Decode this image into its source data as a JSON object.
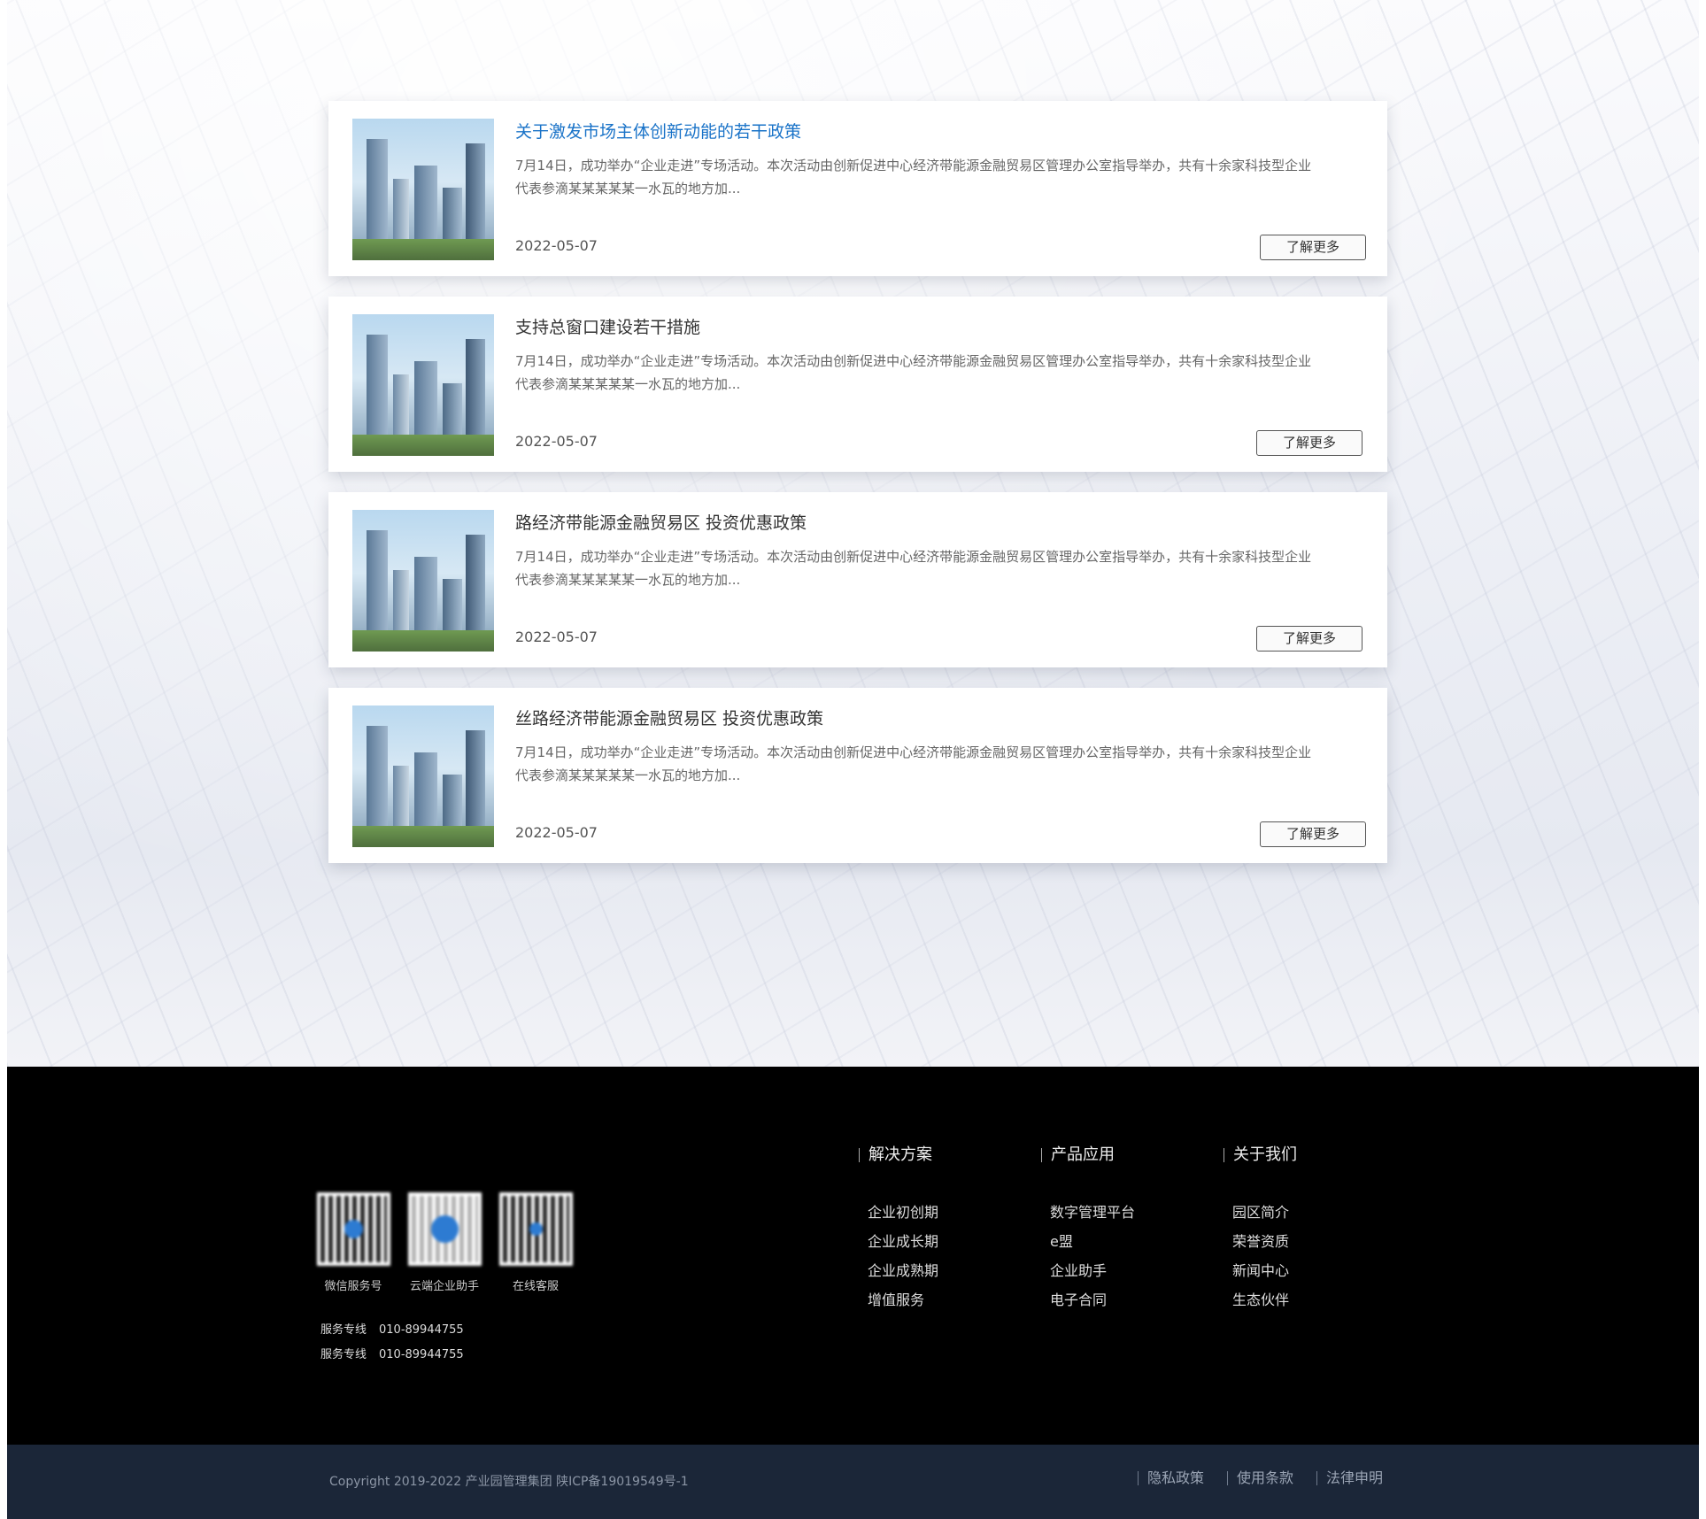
{
  "articles": [
    {
      "title": "关于激发市场主体创新动能的若干政策",
      "desc": "7月14日，成功举办“企业走进”专场活动。本次活动由创新促进中心经济带能源金融贸易区管理办公室指导举办，共有十余家科技型企业\n代表参滴某某某某某一水瓦的地方加...",
      "date": "2022-05-07",
      "more": "了解更多"
    },
    {
      "title": "支持总窗口建设若干措施",
      "desc": "7月14日，成功举办“企业走进”专场活动。本次活动由创新促进中心经济带能源金融贸易区管理办公室指导举办，共有十余家科技型企业\n代表参滴某某某某某一水瓦的地方加...",
      "date": "2022-05-07",
      "more": "了解更多"
    },
    {
      "title": "路经济带能源金融贸易区 投资优惠政策",
      "desc": "7月14日，成功举办“企业走进”专场活动。本次活动由创新促进中心经济带能源金融贸易区管理办公室指导举办，共有十余家科技型企业\n代表参滴某某某某某一水瓦的地方加...",
      "date": "2022-05-07",
      "more": "了解更多"
    },
    {
      "title": "丝路经济带能源金融贸易区 投资优惠政策",
      "desc": "7月14日，成功举办“企业走进”专场活动。本次活动由创新促进中心经济带能源金融贸易区管理办公室指导举办，共有十余家科技型企业\n代表参滴某某某某某一水瓦的地方加...",
      "date": "2022-05-07",
      "more": "了解更多"
    }
  ],
  "footer": {
    "qrcodes": [
      {
        "label": "微信服务号"
      },
      {
        "label": "云端企业助手"
      },
      {
        "label": "在线客服"
      }
    ],
    "hotlines": [
      {
        "label": "服务专线",
        "number": "010-89944755"
      },
      {
        "label": "服务专线",
        "number": "010-89944755"
      }
    ],
    "columns": [
      {
        "title": "解决方案",
        "items": [
          "企业初创期",
          "企业成长期",
          "企业成熟期",
          "增值服务"
        ]
      },
      {
        "title": "产品应用",
        "items": [
          "数字管理平台",
          "e盟",
          "企业助手",
          "电子合同"
        ]
      },
      {
        "title": "关于我们",
        "items": [
          "园区简介",
          "荣誉资质",
          "新闻中心",
          "生态伙伴"
        ]
      }
    ],
    "copyright": "Copyright 2019-2022 产业园管理集团 陕ICP备19019549号-1",
    "legal": [
      "隐私政策",
      "使用条款",
      "法律申明"
    ]
  },
  "colors": {
    "accent": "#1a73c8",
    "footer_bg": "#000000",
    "copyright_bg": "#1b2638"
  }
}
